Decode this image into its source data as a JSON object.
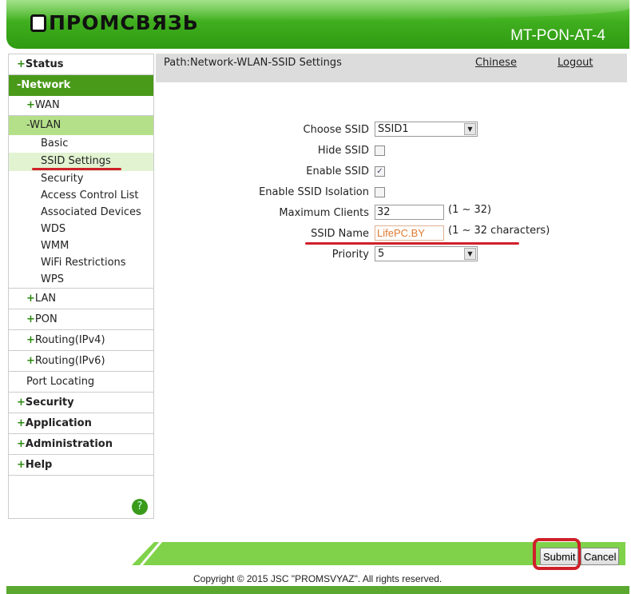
{
  "header": {
    "logo_text": "ПРОМСВЯЗЬ",
    "model": "MT-PON-AT-4"
  },
  "path": {
    "text": "Path:Network-WLAN-SSID Settings",
    "chinese": "Chinese",
    "logout": "Logout"
  },
  "sidebar": {
    "status": "Status",
    "network": "-Network",
    "wan": "WAN",
    "wlan": "-WLAN",
    "wlan_items": [
      "Basic",
      "SSID Settings",
      "Security",
      "Access Control List",
      "Associated Devices",
      "WDS",
      "WMM",
      "WiFi Restrictions",
      "WPS"
    ],
    "lan": "LAN",
    "pon": "PON",
    "routing4": "Routing(IPv4)",
    "routing6": "Routing(IPv6)",
    "port": "Port Locating",
    "security": "Security",
    "application": "Application",
    "administration": "Administration",
    "help": "Help",
    "help_icon": "?"
  },
  "form": {
    "choose_ssid": {
      "label": "Choose SSID",
      "value": "SSID1"
    },
    "hide_ssid": {
      "label": "Hide SSID",
      "checked": false
    },
    "enable_ssid": {
      "label": "Enable SSID",
      "checked": true
    },
    "isolation": {
      "label": "Enable SSID Isolation",
      "checked": false
    },
    "max_clients": {
      "label": "Maximum Clients",
      "value": "32",
      "hint": "(1 ~ 32)"
    },
    "ssid_name": {
      "label": "SSID Name",
      "value": "LifePC.BY",
      "hint": "(1 ~ 32 characters)"
    },
    "priority": {
      "label": "Priority",
      "value": "5"
    }
  },
  "buttons": {
    "submit": "Submit",
    "cancel": "Cancel"
  },
  "footer": {
    "copyright": "Copyright © 2015 JSC \"PROMSVYAZ\". All rights reserved."
  },
  "colors": {
    "accent": "#3fae1e",
    "nav_active": "#4a9a1a",
    "annotation": "#d0202a"
  }
}
